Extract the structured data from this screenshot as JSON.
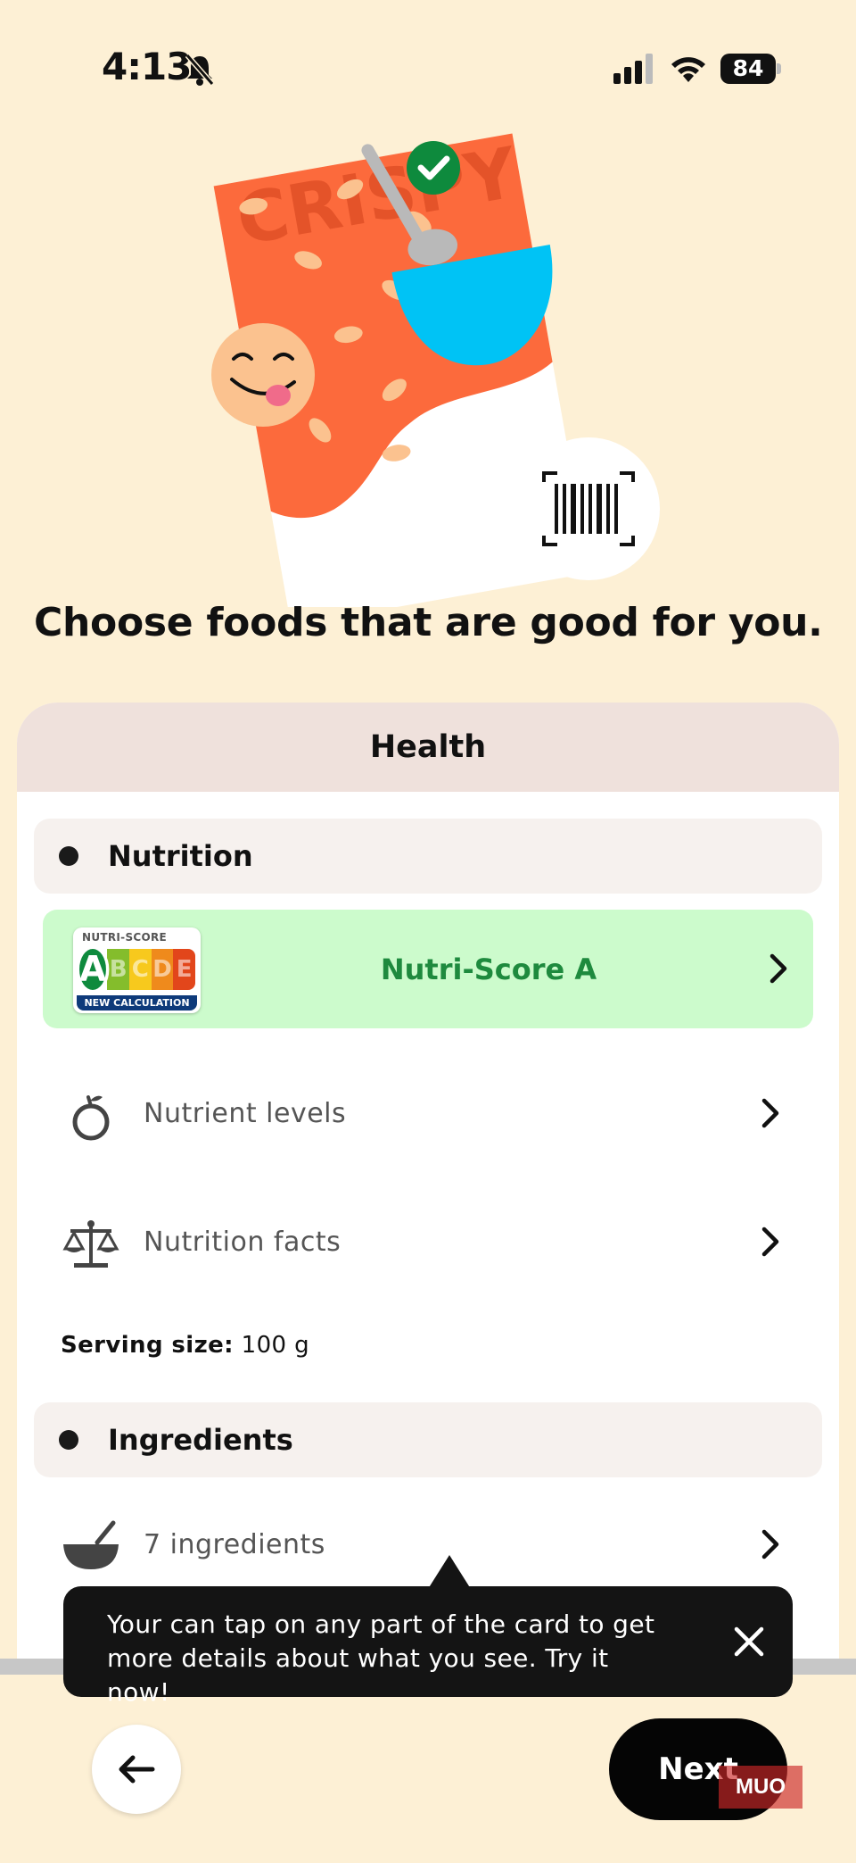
{
  "status_bar": {
    "time": "4:13",
    "battery": "84"
  },
  "illustration": {
    "package_text": "CRISPY",
    "colors": {
      "package": "#fc6a3c",
      "bowl": "#00c3f5",
      "check": "#0e8a3d",
      "face": "#fbc28f"
    }
  },
  "headline": "Choose foods that are good for you.",
  "card": {
    "title": "Health",
    "nutrition_section": {
      "label": "Nutrition",
      "nutri_score": {
        "logo_top": "NUTRI-SCORE",
        "letters": [
          "A",
          "B",
          "C",
          "D",
          "E"
        ],
        "logo_bottom": "NEW CALCULATION",
        "label": "Nutri-Score A",
        "grade": "A"
      },
      "rows": [
        {
          "label": "Nutrient levels",
          "icon": "apple-icon"
        },
        {
          "label": "Nutrition facts",
          "icon": "scale-icon"
        }
      ],
      "serving_label": "Serving size:",
      "serving_value": " 100 g"
    },
    "ingredients_section": {
      "label": "Ingredients",
      "rows": [
        {
          "label": "7 ingredients",
          "icon": "mortar-icon"
        }
      ]
    }
  },
  "tooltip": {
    "text": "Your can tap on any part of the card to get more details about what you see. Try it now!"
  },
  "footer": {
    "next_label": "Next",
    "back_icon": "arrow-left-icon"
  },
  "watermark": "MUO",
  "colors": {
    "background": "#fdf0d5",
    "card_header": "#efe1dc",
    "nutri_row": "#ccfbcc",
    "nutri_text": "#1e8a3e"
  }
}
